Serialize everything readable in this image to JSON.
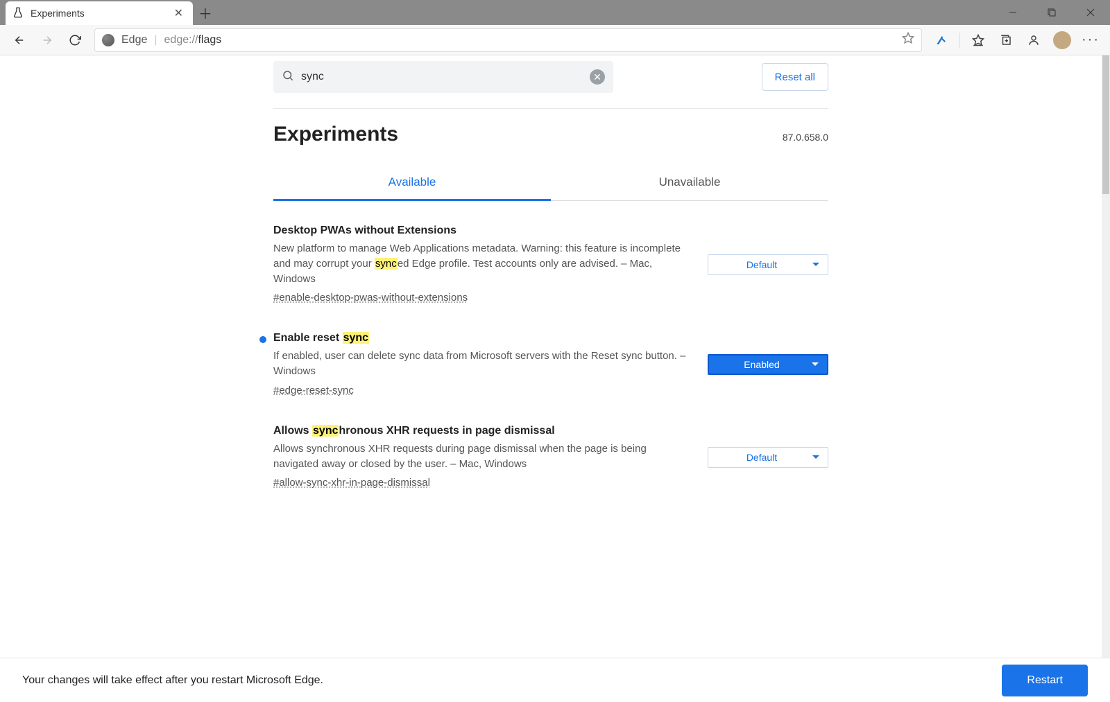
{
  "browser_tab": {
    "title": "Experiments"
  },
  "toolbar": {
    "segment_label": "Edge",
    "scheme": "edge://",
    "path": "flags"
  },
  "search": {
    "value": "sync",
    "reset_label": "Reset all"
  },
  "page": {
    "title": "Experiments",
    "version": "87.0.658.0"
  },
  "tabs": {
    "available": "Available",
    "unavailable": "Unavailable"
  },
  "flags": [
    {
      "title_pre": "Desktop PWAs without Extensions",
      "title_mark": "",
      "title_post": "",
      "desc_pre": "New platform to manage Web Applications metadata. Warning: this feature is incomplete and may corrupt your ",
      "desc_mark": "sync",
      "desc_post": "ed Edge profile. Test accounts only are advised. – Mac, Windows",
      "hash": "#enable-desktop-pwas-without-extensions",
      "value": "Default",
      "changed": false
    },
    {
      "title_pre": "Enable reset ",
      "title_mark": "sync",
      "title_post": "",
      "desc_pre": "If enabled, user can delete sync data from Microsoft servers with the Reset sync button. – Windows",
      "desc_mark": "",
      "desc_post": "",
      "hash": "#edge-reset-sync",
      "value": "Enabled",
      "changed": true
    },
    {
      "title_pre": "Allows ",
      "title_mark": "sync",
      "title_post": "hronous XHR requests in page dismissal",
      "desc_pre": "Allows synchronous XHR requests during page dismissal when the page is being navigated away or closed by the user. – Mac, Windows",
      "desc_mark": "",
      "desc_post": "",
      "hash": "#allow-sync-xhr-in-page-dismissal",
      "value": "Default",
      "changed": false
    }
  ],
  "footer": {
    "message": "Your changes will take effect after you restart Microsoft Edge.",
    "button": "Restart"
  }
}
